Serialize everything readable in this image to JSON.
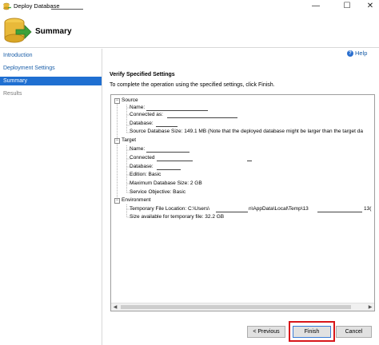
{
  "window": {
    "title": "Deploy Database",
    "controls": {
      "minimize": "—",
      "maximize": "☐",
      "close": "✕"
    }
  },
  "header": {
    "title": "Summary"
  },
  "nav": {
    "items": [
      {
        "label": "Introduction",
        "state": "normal"
      },
      {
        "label": "Deployment Settings",
        "state": "normal"
      },
      {
        "label": "Summary",
        "state": "active"
      },
      {
        "label": "Results",
        "state": "disabled"
      }
    ]
  },
  "help": {
    "label": "Help"
  },
  "main": {
    "section_title": "Verify Specified Settings",
    "instruction": "To complete the operation using the specified settings, click Finish."
  },
  "tree": {
    "source": {
      "label": "Source",
      "name": "Name:",
      "connected_as": "Connected as:",
      "database": "Database:",
      "database_size": "Source Database Size: 149.1 MB (Note that the deployed database might be larger than the target da"
    },
    "target": {
      "label": "Target",
      "name": "Name:",
      "connected_as": "Connected",
      "database": "Database:",
      "edition": "Edition: Basic",
      "max_size": "Maximum Database Size: 2 GB",
      "service_objective": "Service Objective: Basic"
    },
    "environment": {
      "label": "Environment",
      "temp_location_prefix": "Temporary File Location: C:\\Users\\",
      "temp_location_mid": "n\\AppData\\Local\\Temp\\13",
      "temp_location_suffix": "13(",
      "temp_size": "Size available for temporary file: 32.2 GB"
    }
  },
  "buttons": {
    "previous": "< Previous",
    "finish": "Finish",
    "cancel": "Cancel"
  },
  "colors": {
    "accent": "#1f6fd1",
    "link": "#1a5ea8",
    "highlight": "#d8161a"
  }
}
